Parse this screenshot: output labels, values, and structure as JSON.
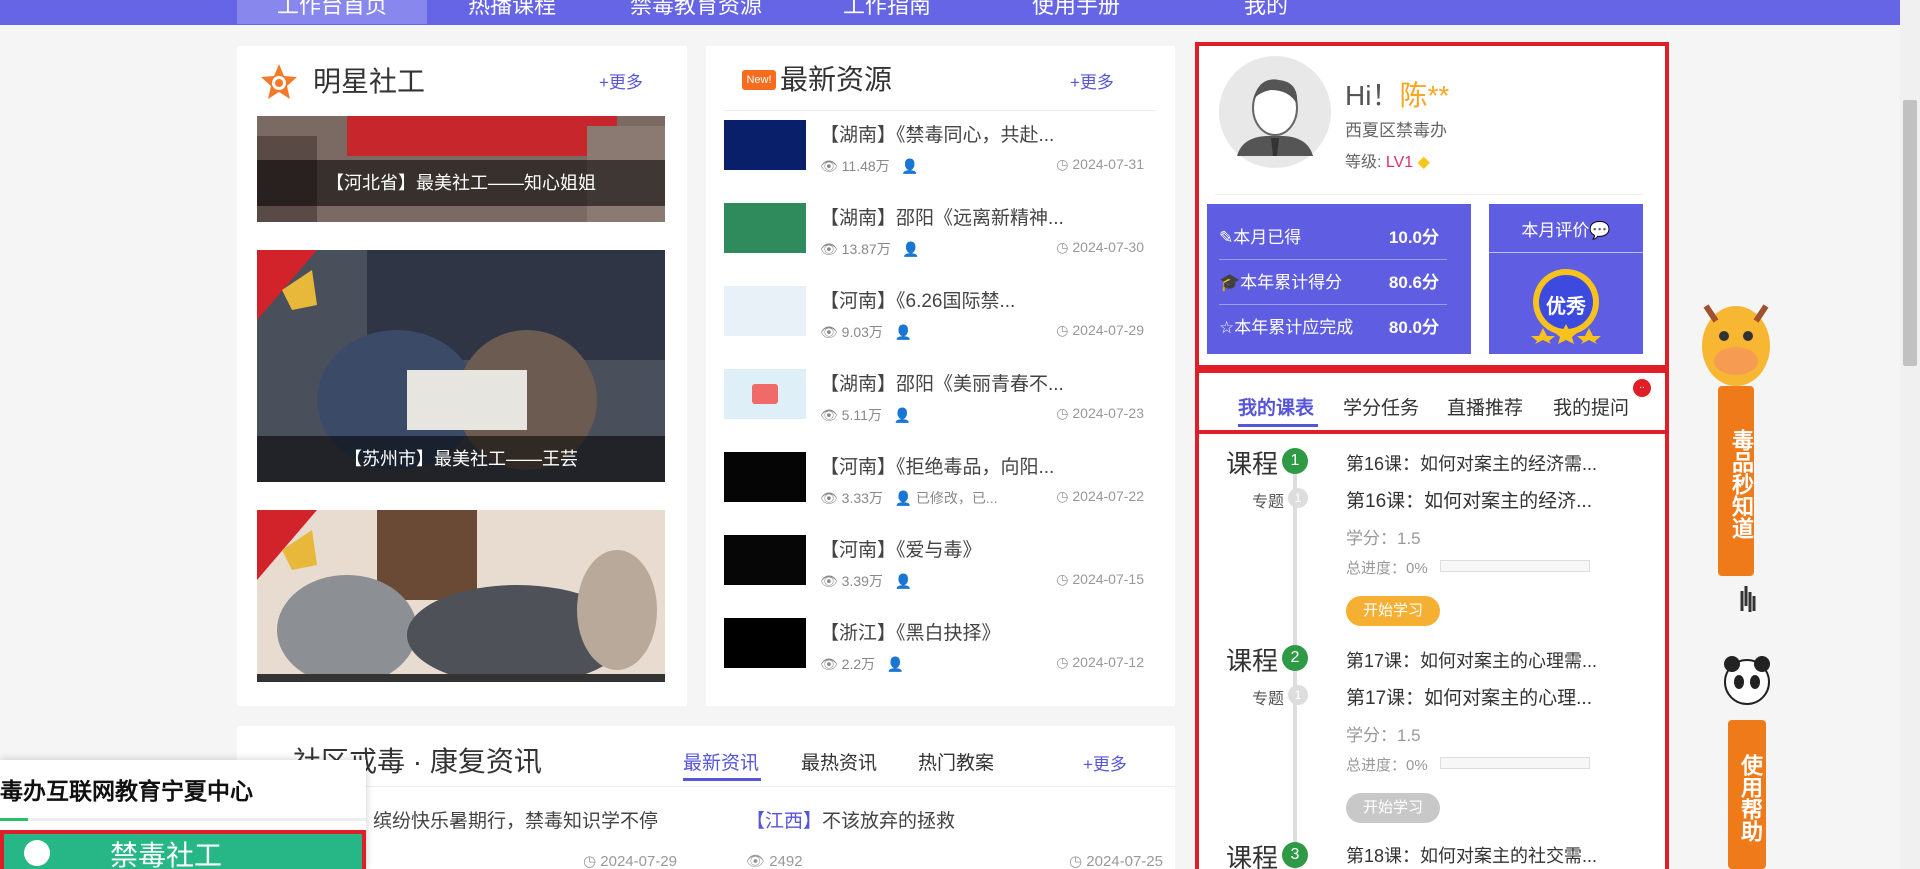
{
  "nav": {
    "items": [
      "工作台首页",
      "热播课程",
      "禁毒教育资源",
      "工作指南",
      "使用手册",
      "我的"
    ]
  },
  "star_workers": {
    "title": "明星社工",
    "more": "+更多",
    "cards": [
      {
        "caption": "【河北省】最美社工——知心姐姐"
      },
      {
        "caption": "【苏州市】最美社工——王芸"
      },
      {
        "caption": ""
      }
    ]
  },
  "resources": {
    "title": "最新资源",
    "badge": "New!",
    "more": "+更多",
    "items": [
      {
        "title": "【湖南】《禁毒同心，共赴...",
        "views": "11.48万",
        "author": "",
        "date": "2024-07-31",
        "thumb_color": "#0a1f6a"
      },
      {
        "title": "【湖南】邵阳《远离新精神...",
        "views": "13.87万",
        "author": "",
        "date": "2024-07-30",
        "thumb_color": "#2f8a5c"
      },
      {
        "title": "【河南】《6.26国际禁...",
        "views": "9.03万",
        "author": "",
        "date": "2024-07-29",
        "thumb_color": "#e8f0f8"
      },
      {
        "title": "【湖南】邵阳《美丽青春不...",
        "views": "5.11万",
        "author": "",
        "date": "2024-07-23",
        "thumb_color": "#dfeff8"
      },
      {
        "title": "【河南】《拒绝毒品，向阳...",
        "views": "3.33万",
        "author": "已修改，已...",
        "date": "2024-07-22",
        "thumb_color": "#050505"
      },
      {
        "title": "【河南】《爱与毒》",
        "views": "3.39万",
        "author": "",
        "date": "2024-07-15",
        "thumb_color": "#060606"
      },
      {
        "title": "【浙江】《黑白抉择》",
        "views": "2.2万",
        "author": "",
        "date": "2024-07-12",
        "thumb_color": "#000000"
      }
    ]
  },
  "profile": {
    "greeting": "Hi！",
    "name": "陈**",
    "org": "西夏区禁毒办",
    "level_label": "等级:",
    "level": "LV1",
    "stats": [
      {
        "label": "本月已得",
        "value": "10.0分",
        "icon": "pencil-icon"
      },
      {
        "label": "本年累计得分",
        "value": "80.6分",
        "icon": "graduation-cap-icon"
      },
      {
        "label": "本年累计应完成",
        "value": "80.0分",
        "icon": "star-icon"
      }
    ],
    "eval_title": "本月评价",
    "eval_badge": "优秀"
  },
  "tabs": [
    {
      "label": "我的课表",
      "active": true
    },
    {
      "label": "学分任务",
      "active": false
    },
    {
      "label": "直播推荐",
      "active": false
    },
    {
      "label": "我的提问",
      "active": false
    }
  ],
  "tab_badge": "..",
  "courses": [
    {
      "label": "课程",
      "num": "1",
      "topic": "专题",
      "topic_num": "1",
      "line1": "第16课：如何对案主的经济需...",
      "line2": "第16课：如何对案主的经济...",
      "credit": "学分：1.5",
      "progress_label": "总进度：",
      "progress": "0%",
      "button": "开始学习",
      "button_color": "#f5b034"
    },
    {
      "label": "课程",
      "num": "2",
      "topic": "专题",
      "topic_num": "1",
      "line1": "第17课：如何对案主的心理需...",
      "line2": "第17课：如何对案主的心理...",
      "credit": "学分：1.5",
      "progress_label": "总进度：",
      "progress": "0%",
      "button": "开始学习",
      "button_color": "#c8c8c8"
    },
    {
      "label": "课程",
      "num": "3",
      "line1": "第18课：如何对案主的社交需..."
    }
  ],
  "community_news": {
    "title": "社区戒毒 · 康复资讯",
    "tabs": [
      "最新资讯",
      "最热资讯",
      "热门教案"
    ],
    "more": "+更多",
    "items": [
      {
        "title": "缤纷快乐暑期行，禁毒知识学不停",
        "date": "2024-07-29"
      },
      {
        "region": "【江西】",
        "title": "不该放弃的拯救",
        "views": "2492",
        "date": "2024-07-25"
      }
    ]
  },
  "float_window": {
    "title": "毒办互联网教育宁夏中心",
    "button": "禁毒社工"
  },
  "side_banners": [
    {
      "text": "毒品秒知道"
    },
    {
      "text": "使用帮助"
    }
  ]
}
